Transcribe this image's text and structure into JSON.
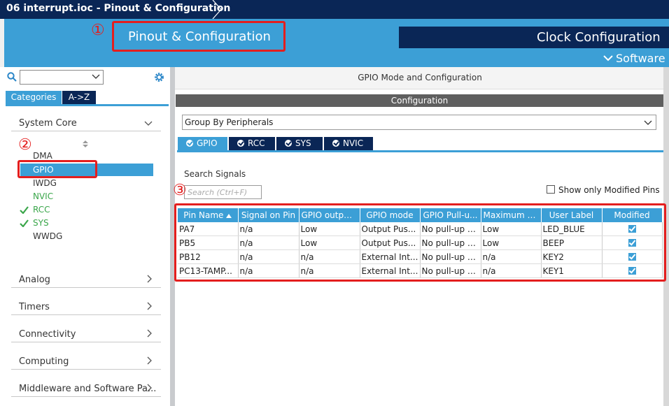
{
  "titlebar": {
    "title": "06 interrupt.ioc - Pinout & Configuration"
  },
  "main_tabs": {
    "pinout": "Pinout & Configuration",
    "clock": "Clock Configuration",
    "software_packs": "Software P"
  },
  "left_panel": {
    "tabs": [
      "Categories",
      "A->Z"
    ],
    "categories": [
      {
        "label": "System Core",
        "expanded": true
      },
      {
        "label": "Analog",
        "expanded": false
      },
      {
        "label": "Timers",
        "expanded": false
      },
      {
        "label": "Connectivity",
        "expanded": false
      },
      {
        "label": "Computing",
        "expanded": false
      },
      {
        "label": "Middleware and Software Pa..."
      }
    ],
    "system_core_items": [
      {
        "label": "DMA",
        "state": "none"
      },
      {
        "label": "GPIO",
        "state": "selected"
      },
      {
        "label": "IWDG",
        "state": "none"
      },
      {
        "label": "NVIC",
        "state": "green"
      },
      {
        "label": "RCC",
        "state": "checked"
      },
      {
        "label": "SYS",
        "state": "checked"
      },
      {
        "label": "WWDG",
        "state": "none"
      }
    ]
  },
  "right_panel": {
    "title": "GPIO Mode and Configuration",
    "configuration": "Configuration",
    "group_by": "Group By Peripherals",
    "peripheral_tabs": [
      "GPIO",
      "RCC",
      "SYS",
      "NVIC"
    ],
    "search_label": "Search Signals",
    "search_placeholder": "Search (Ctrl+F)",
    "show_modified": "Show only Modified Pins",
    "table": {
      "columns": [
        "Pin Name",
        "Signal on Pin",
        "GPIO output...",
        "GPIO mode",
        "GPIO Pull-u...",
        "Maximum o...",
        "User Label",
        "Modified"
      ],
      "rows": [
        [
          "PA7",
          "n/a",
          "Low",
          "Output Pus...",
          "No pull-up a...",
          "Low",
          "LED_BLUE",
          true
        ],
        [
          "PB5",
          "n/a",
          "Low",
          "Output Pus...",
          "No pull-up a...",
          "Low",
          "BEEP",
          true
        ],
        [
          "PB12",
          "n/a",
          "n/a",
          "External Int...",
          "No pull-up a...",
          "n/a",
          "KEY2",
          true
        ],
        [
          "PC13-TAMP...",
          "n/a",
          "n/a",
          "External Int...",
          "No pull-up a...",
          "n/a",
          "KEY1",
          true
        ]
      ]
    }
  },
  "annotations": {
    "m1": "①",
    "m2": "②",
    "m3": "③"
  },
  "colors": {
    "navy": "#0a2656",
    "accent": "#3c9fd6",
    "annotation": "#e41e1e",
    "green": "#3aa64a"
  }
}
